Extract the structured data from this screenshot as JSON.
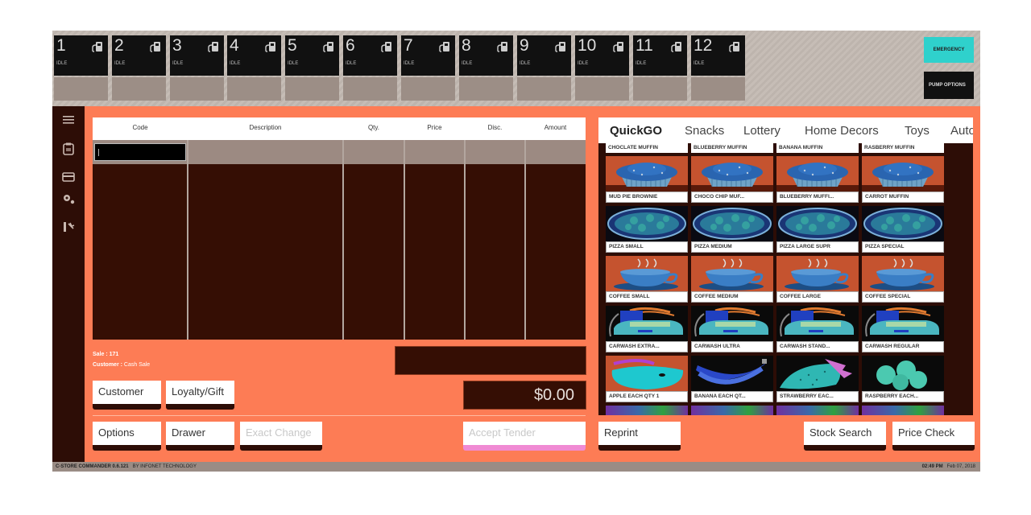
{
  "pumps": [
    {
      "number": "1",
      "status": "IDLE"
    },
    {
      "number": "2",
      "status": "IDLE"
    },
    {
      "number": "3",
      "status": "IDLE"
    },
    {
      "number": "4",
      "status": "IDLE"
    },
    {
      "number": "5",
      "status": "IDLE"
    },
    {
      "number": "6",
      "status": "IDLE"
    },
    {
      "number": "7",
      "status": "IDLE"
    },
    {
      "number": "8",
      "status": "IDLE"
    },
    {
      "number": "9",
      "status": "IDLE"
    },
    {
      "number": "10",
      "status": "IDLE"
    },
    {
      "number": "11",
      "status": "IDLE"
    },
    {
      "number": "12",
      "status": "IDLE"
    }
  ],
  "pump_controls": {
    "emergency_label": "EMERGENCY",
    "pump_options_label": "PUMP OPTIONS",
    "emergency_color": "#2fd1cc"
  },
  "sidebar": {
    "icons": [
      "menu-icon",
      "clipboard-icon",
      "card-icon",
      "settings-icon",
      "exit-icon"
    ]
  },
  "grid": {
    "columns": [
      "Code",
      "Description",
      "Qty.",
      "Price",
      "Disc.",
      "Amount"
    ],
    "code_input_value": ""
  },
  "sale": {
    "sale_label": "Sale :",
    "sale_number": "171",
    "customer_label": "Customer :",
    "customer_value": "Cash Sale",
    "total": "$0.00"
  },
  "buttons": {
    "customer": "Customer",
    "loyalty": "Loyalty/Gift",
    "options": "Options",
    "drawer": "Drawer",
    "exact_change": "Exact Change",
    "accept_tender": "Accept Tender",
    "reprint": "Reprint",
    "stock_search": "Stock Search",
    "price_check": "Price Check"
  },
  "categories": {
    "tabs": [
      "QuickGO",
      "Snacks",
      "Lottery",
      "Home Decors",
      "Toys",
      "Auto"
    ],
    "active": "QuickGO"
  },
  "products": {
    "top_row_labels": [
      "CHOCLATE MUFFIN",
      "BLUEBERRY MUFFIN",
      "BANANA MUFFIN",
      "RASBERRY MUFFIN"
    ],
    "rows": [
      {
        "type": "muffin",
        "items": [
          "MUD PIE BROWNIE",
          "CHOCO CHIP MUF...",
          "BLUEBERRY  MUFFI...",
          "CARROT  MUFFIN"
        ]
      },
      {
        "type": "pizza",
        "items": [
          "PIZZA  SMALL",
          "PIZZA  MEDIUM",
          "PIZZA LARGE SUPR",
          "PIZZA SPECIAL"
        ]
      },
      {
        "type": "coffee",
        "items": [
          "COFFEE SMALL",
          "COFFEE MEDIUM",
          "COFFEE LARGE",
          "COFFEE SPECIAL"
        ]
      },
      {
        "type": "carwash",
        "items": [
          "CARWASH EXTRA...",
          "CARWASH ULTRA",
          "CARWASH STAND...",
          "CARWASH REGULAR"
        ]
      },
      {
        "type": "fruit",
        "items": [
          "APPLE EACH QTY 1",
          "BANANA EACH QT...",
          "STRAWBERRY EAC...",
          "RASPBERRY EACH..."
        ]
      }
    ]
  },
  "footer": {
    "app_name": "C-STORE COMMANDER 0.6.121",
    "vendor": "BY INFONET TECHNOLOGY",
    "time": "02:49 PM",
    "date": "Feb 07, 2018"
  }
}
